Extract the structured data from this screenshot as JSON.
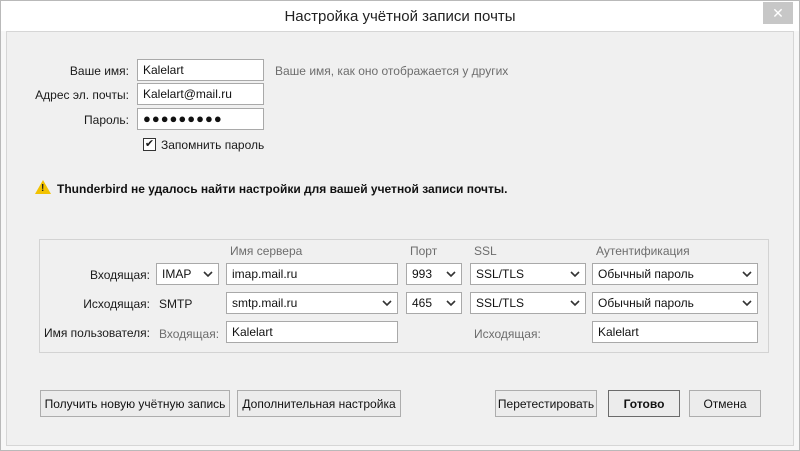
{
  "window": {
    "title": "Настройка учётной записи почты",
    "close_glyph": "✕"
  },
  "account": {
    "name_label": "Ваше имя:",
    "name_value": "Kalelart",
    "name_hint": "Ваше имя, как оно отображается у других",
    "email_label": "Адрес эл. почты:",
    "email_value": "Kalelart@mail.ru",
    "password_label": "Пароль:",
    "password_value": "●●●●●●●●●",
    "remember_label": "Запомнить пароль",
    "remember_checked_glyph": "✔"
  },
  "warning": {
    "icon": "warning-icon",
    "mark": "!",
    "text": "Thunderbird не удалось найти настройки для вашей учетной записи почты."
  },
  "server_table": {
    "headers": {
      "server": "Имя сервера",
      "port": "Порт",
      "ssl": "SSL",
      "auth": "Аутентификация"
    },
    "incoming": {
      "label": "Входящая:",
      "protocol": "IMAP",
      "server": "imap.mail.ru",
      "port": "993",
      "ssl": "SSL/TLS",
      "auth": "Обычный пароль"
    },
    "outgoing": {
      "label": "Исходящая:",
      "protocol": "SMTP",
      "server": "smtp.mail.ru",
      "port": "465",
      "ssl": "SSL/TLS",
      "auth": "Обычный пароль"
    },
    "username": {
      "label": "Имя пользователя:",
      "incoming_label": "Входящая:",
      "incoming_value": "Kalelart",
      "outgoing_label": "Исходящая:",
      "outgoing_value": "Kalelart"
    }
  },
  "buttons": {
    "new_account": "Получить новую учётную запись",
    "advanced": "Дополнительная настройка",
    "retest": "Перетестировать",
    "done": "Готово",
    "cancel": "Отмена"
  },
  "colors": {
    "warning_yellow": "#f2c200",
    "hint_gray": "#6d6d6d"
  }
}
